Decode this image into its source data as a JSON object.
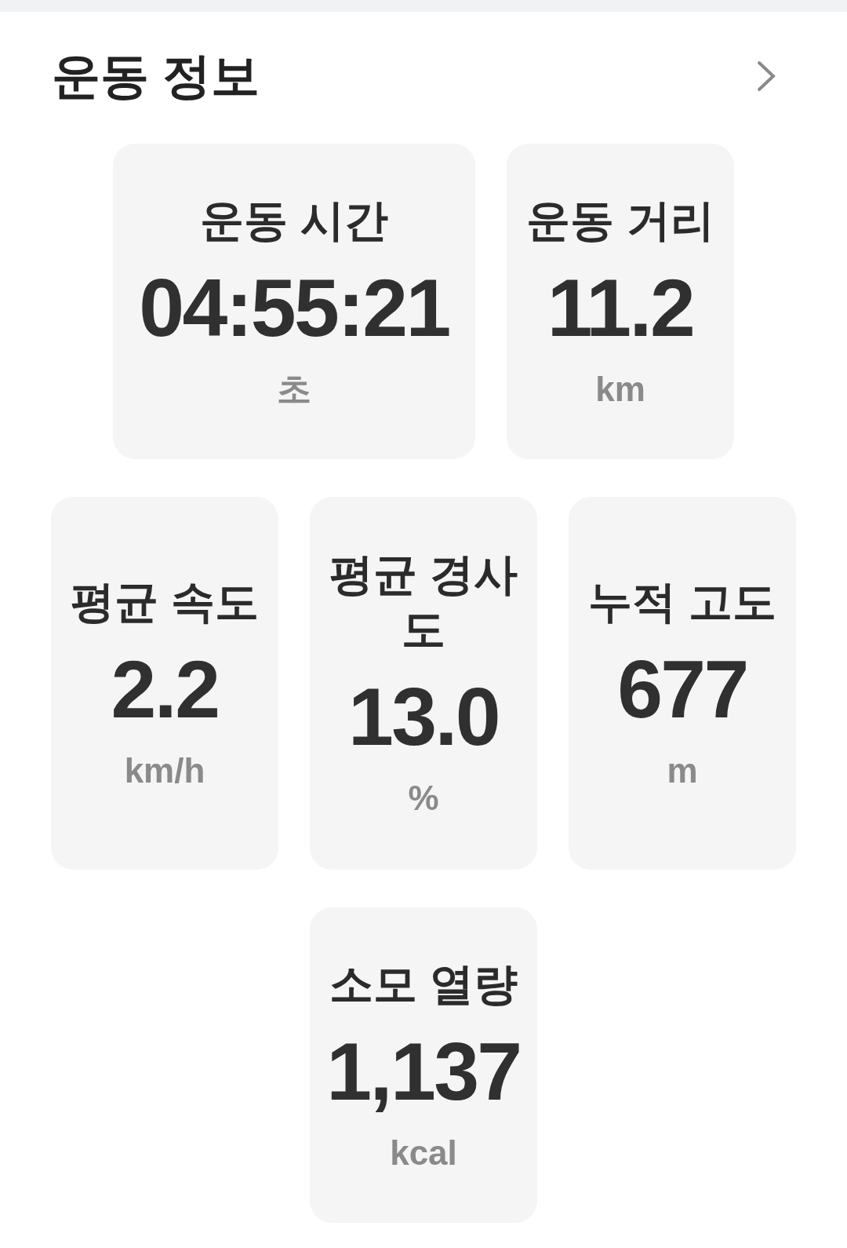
{
  "header": {
    "title": "운동 정보"
  },
  "rows": [
    [
      {
        "label": "운동 시간",
        "value": "04:55:21",
        "unit": "초"
      },
      {
        "label": "운동 거리",
        "value": "11.2",
        "unit": "km"
      }
    ],
    [
      {
        "label": "평균 속도",
        "value": "2.2",
        "unit": "km/h"
      },
      {
        "label": "평균 경사도",
        "value": "13.0",
        "unit": "%"
      },
      {
        "label": "누적 고도",
        "value": "677",
        "unit": "m"
      }
    ],
    [
      {
        "label": "소모 열량",
        "value": "1,137",
        "unit": "kcal"
      }
    ]
  ]
}
